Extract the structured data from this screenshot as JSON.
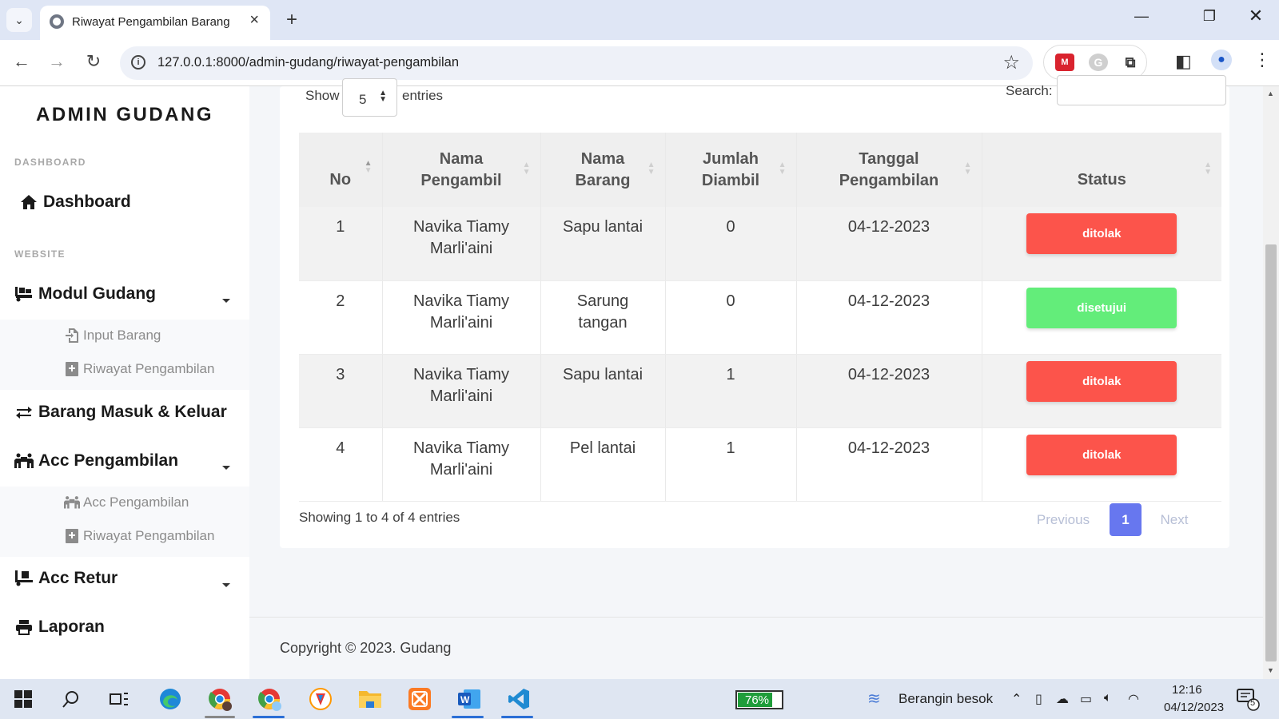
{
  "browser": {
    "tab_title": "Riwayat Pengambilan Barang",
    "url": "127.0.0.1:8000/admin-gudang/riwayat-pengambilan"
  },
  "sidebar": {
    "brand": "ADMIN GUDANG",
    "section_dashboard": "DASHBOARD",
    "dashboard": "Dashboard",
    "section_website": "WEBSITE",
    "modul_gudang": "Modul Gudang",
    "input_barang": "Input Barang",
    "riwayat_pengambilan_1": "Riwayat Pengambilan",
    "barang_masuk_keluar": "Barang Masuk & Keluar",
    "acc_pengambilan": "Acc Pengambilan",
    "acc_pengambilan_sub": "Acc Pengambilan",
    "riwayat_pengambilan_2": "Riwayat Pengambilan",
    "acc_retur": "Acc Retur",
    "laporan": "Laporan"
  },
  "table_controls": {
    "show_label": "Show",
    "entries_value": "5",
    "entries_label": "entries",
    "search_label": "Search:",
    "search_value": ""
  },
  "table": {
    "headers": [
      {
        "line1": "No",
        "line2": ""
      },
      {
        "line1": "Nama",
        "line2": "Pengambil"
      },
      {
        "line1": "Nama",
        "line2": "Barang"
      },
      {
        "line1": "Jumlah",
        "line2": "Diambil"
      },
      {
        "line1": "Tanggal",
        "line2": "Pengambilan"
      },
      {
        "line1": "Status",
        "line2": ""
      }
    ],
    "rows": [
      {
        "no": "1",
        "pengambil_1": "Navika Tiamy",
        "pengambil_2": "Marli'aini",
        "barang_1": "Sapu lantai",
        "barang_2": "",
        "jumlah": "0",
        "tanggal": "04-12-2023",
        "status": "ditolak"
      },
      {
        "no": "2",
        "pengambil_1": "Navika Tiamy",
        "pengambil_2": "Marli'aini",
        "barang_1": "Sarung",
        "barang_2": "tangan",
        "jumlah": "0",
        "tanggal": "04-12-2023",
        "status": "disetujui"
      },
      {
        "no": "3",
        "pengambil_1": "Navika Tiamy",
        "pengambil_2": "Marli'aini",
        "barang_1": "Sapu lantai",
        "barang_2": "",
        "jumlah": "1",
        "tanggal": "04-12-2023",
        "status": "ditolak"
      },
      {
        "no": "4",
        "pengambil_1": "Navika Tiamy",
        "pengambil_2": "Marli'aini",
        "barang_1": "Pel lantai",
        "barang_2": "",
        "jumlah": "1",
        "tanggal": "04-12-2023",
        "status": "ditolak"
      }
    ]
  },
  "colors": {
    "ditolak": "#fc544b",
    "disetujui": "#63ed7a",
    "primary": "#6777ef"
  },
  "pagination": {
    "info": "Showing 1 to 4 of 4 entries",
    "previous": "Previous",
    "page": "1",
    "next": "Next"
  },
  "footer": {
    "copyright": "Copyright © 2023. Gudang"
  },
  "taskbar": {
    "battery_percent": "76%",
    "battery_level": 0.76,
    "weather": "Berangin besok",
    "time": "12:16",
    "date": "04/12/2023",
    "notifications": "5"
  }
}
